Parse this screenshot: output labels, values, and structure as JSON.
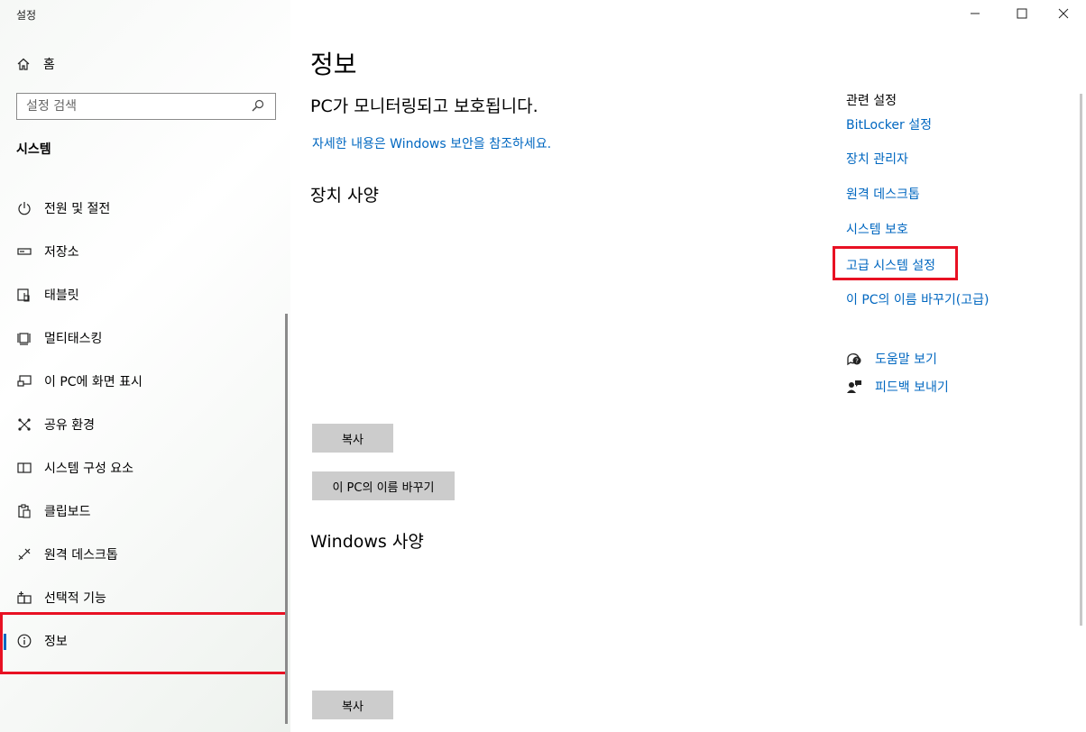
{
  "window": {
    "title": "설정"
  },
  "sidebar": {
    "home_label": "홈",
    "search_placeholder": "설정 검색",
    "section_title": "시스템",
    "items": [
      {
        "label": "전원 및 절전",
        "icon": "power-icon"
      },
      {
        "label": "저장소",
        "icon": "storage-icon"
      },
      {
        "label": "태블릿",
        "icon": "tablet-icon"
      },
      {
        "label": "멀티태스킹",
        "icon": "multitasking-icon"
      },
      {
        "label": "이 PC에 화면 표시",
        "icon": "project-icon"
      },
      {
        "label": "공유 환경",
        "icon": "shared-icon"
      },
      {
        "label": "시스템 구성 요소",
        "icon": "components-icon"
      },
      {
        "label": "클립보드",
        "icon": "clipboard-icon"
      },
      {
        "label": "원격 데스크톱",
        "icon": "remote-desktop-icon"
      },
      {
        "label": "선택적 기능",
        "icon": "optional-features-icon"
      },
      {
        "label": "정보",
        "icon": "info-icon",
        "active": true
      }
    ]
  },
  "main": {
    "page_title": "정보",
    "protect_text": "PC가 모니터링되고 보호됩니다.",
    "security_link": "자세한 내용은 Windows 보안을 참조하세요.",
    "device_spec_heading": "장치 사양",
    "copy_button": "복사",
    "rename_button": "이 PC의 이름 바꾸기",
    "windows_spec_heading": "Windows 사양",
    "copy_button_2": "복사"
  },
  "related": {
    "title": "관련 설정",
    "links": [
      "BitLocker 설정",
      "장치 관리자",
      "원격 데스크톱",
      "시스템 보호",
      "고급 시스템 설정",
      "이 PC의 이름 바꾸기(고급)"
    ],
    "help_label": "도움말 보기",
    "feedback_label": "피드백 보내기"
  },
  "colors": {
    "accent": "#0067c0",
    "highlight": "#e81123",
    "button_bg": "#cccccc"
  }
}
